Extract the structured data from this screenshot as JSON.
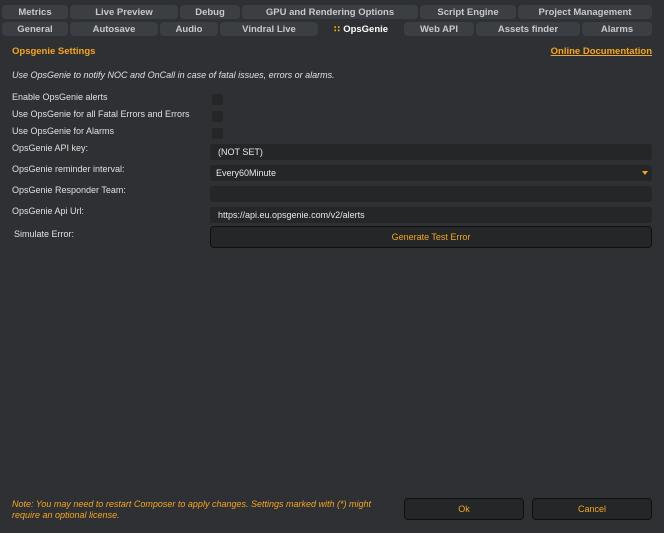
{
  "tabs_row1": [
    "Metrics",
    "Live Preview",
    "Debug",
    "GPU and Rendering Options",
    "Script Engine",
    "Project Management"
  ],
  "tabs_row2": [
    "General",
    "Autosave",
    "Audio",
    "Vindral Live",
    "OpsGenie",
    "Web API",
    "Assets finder",
    "Alarms"
  ],
  "active_tab": "OpsGenie",
  "active_tab_icon": "grip-dots-icon",
  "header": {
    "title": "Opsgenie Settings",
    "doc_link": "Online Documentation"
  },
  "description": "Use OpsGenie to notify NOC and OnCall in case of fatal issues, errors or alarms.",
  "checkboxes": {
    "enable_alerts": {
      "label": "Enable OpsGenie alerts",
      "checked": false
    },
    "fatal_errors": {
      "label": "Use OpsGenie for all Fatal Errors and Errors",
      "checked": false
    },
    "alarms": {
      "label": "Use OpsGenie for Alarms",
      "checked": false
    }
  },
  "fields": {
    "api_key": {
      "label": "OpsGenie API key:",
      "value": "(NOT SET)"
    },
    "reminder": {
      "label": "OpsGenie reminder interval:",
      "value": "Every60Minute"
    },
    "responder": {
      "label": "OpsGenie Responder Team:",
      "value": ""
    },
    "api_url": {
      "label": "OpsGenie Api Url:",
      "value": "https://api.eu.opsgenie.com/v2/alerts"
    }
  },
  "simulate": {
    "label": "Simulate Error:",
    "button": "Generate Test Error"
  },
  "footer": {
    "note": "Note: You may need to restart Composer to apply changes. Settings marked with (*) might require an optional license.",
    "ok": "Ok",
    "cancel": "Cancel"
  },
  "colors": {
    "accent": "#f5a623",
    "background": "#2e3033",
    "control": "#242628",
    "tab": "#3b3e42"
  }
}
